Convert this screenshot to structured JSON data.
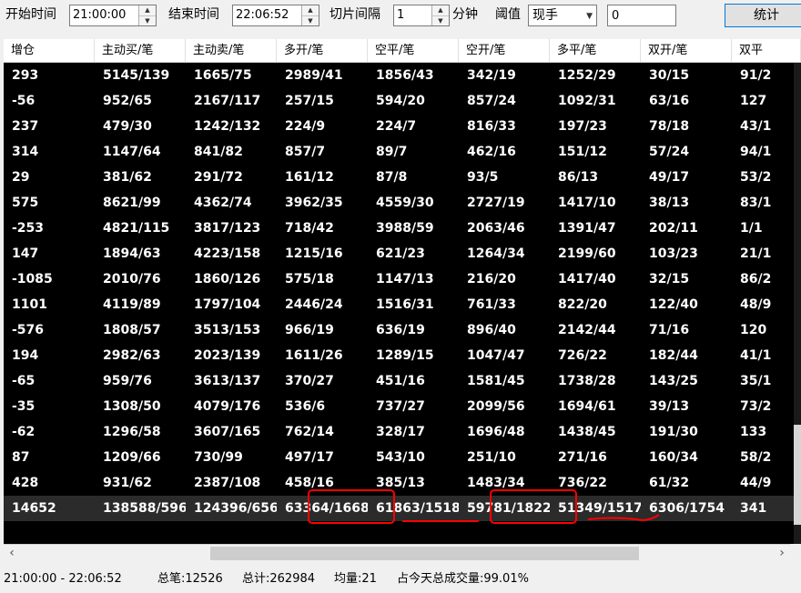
{
  "toolbar": {
    "start_label": "开始时间",
    "start_value": "21:00:00",
    "end_label": "结束时间",
    "end_value": "22:06:52",
    "slice_label": "切片间隔",
    "slice_value": "1",
    "slice_unit": "分钟",
    "threshold_label": "阈值",
    "threshold_select": "现手",
    "threshold_value": "0",
    "stat_button": "统计"
  },
  "table": {
    "columns": [
      "增仓",
      "主动买/笔",
      "主动卖/笔",
      "多开/笔",
      "空平/笔",
      "空开/笔",
      "多平/笔",
      "双开/笔",
      "双平"
    ],
    "rows": [
      [
        "293",
        "5145/139",
        "1665/75",
        "2989/41",
        "1856/43",
        "342/19",
        "1252/29",
        "30/15",
        "91/2"
      ],
      [
        "-56",
        "952/65",
        "2167/117",
        "257/15",
        "594/20",
        "857/24",
        "1092/31",
        "63/16",
        "127"
      ],
      [
        "237",
        "479/30",
        "1242/132",
        "224/9",
        "224/7",
        "816/33",
        "197/23",
        "78/18",
        "43/1"
      ],
      [
        "314",
        "1147/64",
        "841/82",
        "857/7",
        "89/7",
        "462/16",
        "151/12",
        "57/24",
        "94/1"
      ],
      [
        "29",
        "381/62",
        "291/72",
        "161/12",
        "87/8",
        "93/5",
        "86/13",
        "49/17",
        "53/2"
      ],
      [
        "575",
        "8621/99",
        "4362/74",
        "3962/35",
        "4559/30",
        "2727/19",
        "1417/10",
        "38/13",
        "83/1"
      ],
      [
        "-253",
        "4821/115",
        "3817/123",
        "718/42",
        "3988/59",
        "2063/46",
        "1391/47",
        "202/11",
        "1/1"
      ],
      [
        "147",
        "1894/63",
        "4223/158",
        "1215/16",
        "621/23",
        "1264/34",
        "2199/60",
        "103/23",
        "21/1"
      ],
      [
        "-1085",
        "2010/76",
        "1860/126",
        "575/18",
        "1147/13",
        "216/20",
        "1417/40",
        "32/15",
        "86/2"
      ],
      [
        "1101",
        "4119/89",
        "1797/104",
        "2446/24",
        "1516/31",
        "761/33",
        "822/20",
        "122/40",
        "48/9"
      ],
      [
        "-576",
        "1808/57",
        "3513/153",
        "966/19",
        "636/19",
        "896/40",
        "2142/44",
        "71/16",
        "120"
      ],
      [
        "194",
        "2982/63",
        "2023/139",
        "1611/26",
        "1289/15",
        "1047/47",
        "726/22",
        "182/44",
        "41/1"
      ],
      [
        "-65",
        "959/76",
        "3613/137",
        "370/27",
        "451/16",
        "1581/45",
        "1738/28",
        "143/25",
        "35/1"
      ],
      [
        "-35",
        "1308/50",
        "4079/176",
        "536/6",
        "737/27",
        "2099/56",
        "1694/61",
        "39/13",
        "73/2"
      ],
      [
        "-62",
        "1296/58",
        "3607/165",
        "762/14",
        "328/17",
        "1696/48",
        "1438/45",
        "191/30",
        "133"
      ],
      [
        "87",
        "1209/66",
        "730/99",
        "497/17",
        "543/10",
        "251/10",
        "271/16",
        "160/34",
        "58/2"
      ],
      [
        "428",
        "931/62",
        "2387/108",
        "458/16",
        "385/13",
        "1483/34",
        "736/22",
        "61/32",
        "44/9"
      ]
    ],
    "total": [
      "14652",
      "138588/596",
      "124396/656",
      "63364/1668",
      "61863/1518",
      "59781/1822",
      "51349/1517",
      "6306/1754",
      "341"
    ]
  },
  "status": {
    "range": "21:00:00 - 22:06:52",
    "total_trades": "总笔:12526",
    "total": "总计:262984",
    "avg": "均量:21",
    "pct": "占今天总成交量:99.01%"
  },
  "colors": {
    "grid_bg": "#000000",
    "highlight": "#ff0000",
    "total_row": "#2b2b2b"
  },
  "icons": [
    "spin-up-icon",
    "spin-down-icon",
    "chevron-down-icon",
    "scroll-left-icon",
    "scroll-right-icon"
  ]
}
